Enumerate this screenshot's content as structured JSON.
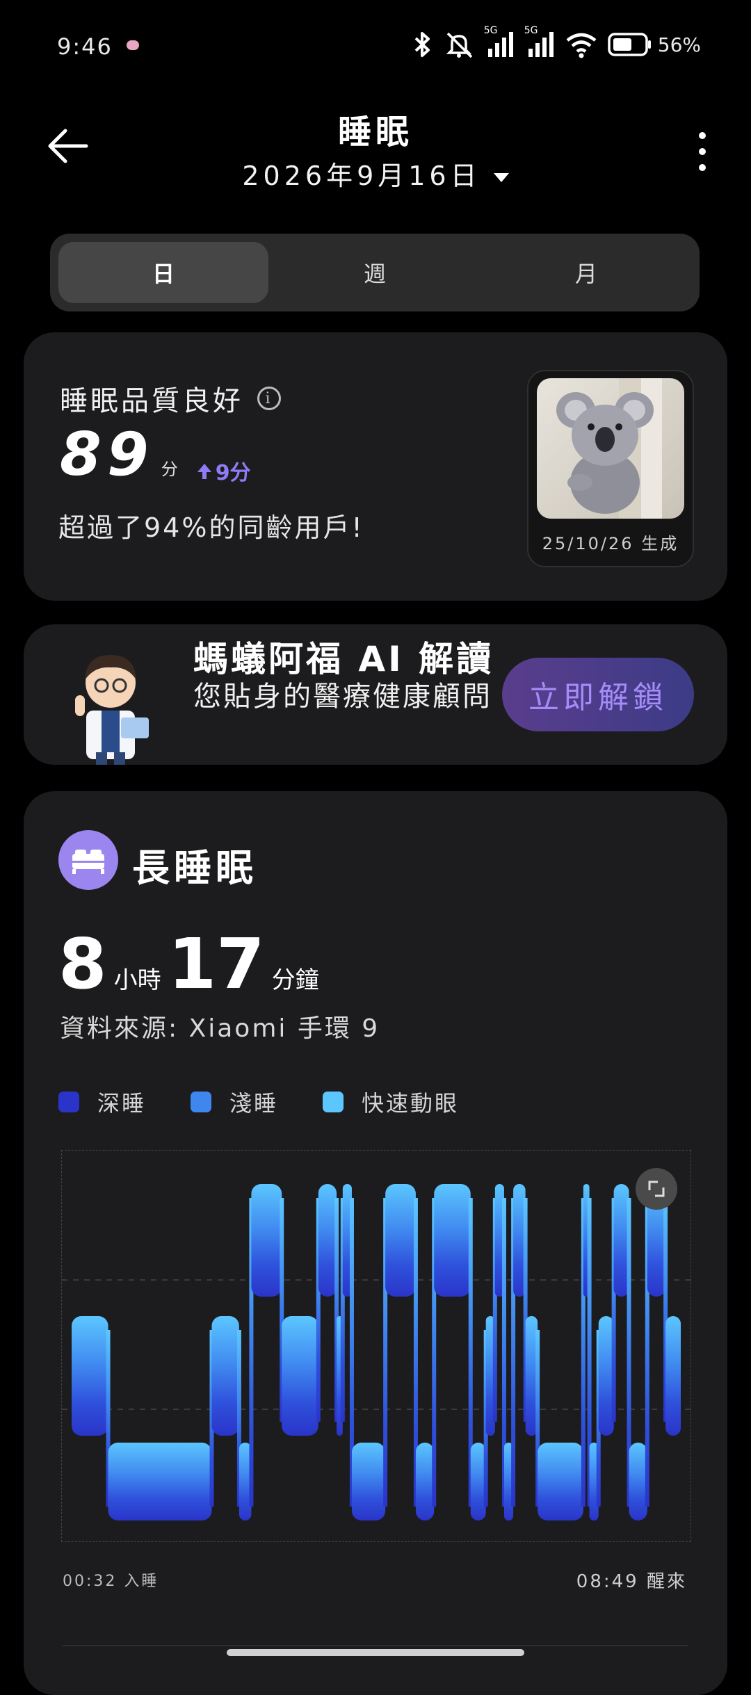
{
  "status_bar": {
    "time": "9:46",
    "battery_text": "56%",
    "signal_tag_1": "5G",
    "signal_tag_2": "5G",
    "icons": [
      "notification-dot-icon",
      "bluetooth-icon",
      "mute-icon",
      "signal-icon",
      "signal-icon",
      "wifi-icon",
      "battery-icon"
    ]
  },
  "header": {
    "title": "睡眠",
    "date": "2026年9月16日"
  },
  "tabs": [
    {
      "label": "日",
      "active": true
    },
    {
      "label": "週",
      "active": false
    },
    {
      "label": "月",
      "active": false
    }
  ],
  "quality_card": {
    "title": "睡眠品質良好",
    "score": "89",
    "score_unit": "分",
    "delta": "9分",
    "beat_text": "超過了94%的同齡用戶!",
    "avatar_caption": "25/10/26 生成"
  },
  "ai_card": {
    "title": "螞蟻阿福 AI 解讀",
    "subtitle": "您貼身的醫療健康顧問",
    "button": "立即解鎖"
  },
  "sleep_card": {
    "title": "長睡眠",
    "hours": "8",
    "hours_unit": "小時",
    "minutes": "17",
    "minutes_unit": "分鐘",
    "source": "資料來源: Xiaomi 手環 9",
    "legend": [
      {
        "label": "深睡",
        "color": "#2a34c9"
      },
      {
        "label": "淺睡",
        "color": "#3f87ef"
      },
      {
        "label": "快速動眼",
        "color": "#5cc6ff"
      }
    ],
    "start_label": "00:32 入睡",
    "end_label": "08:49 醒來"
  },
  "chart_data": {
    "type": "area",
    "title": "",
    "stages": [
      "快速動眼",
      "淺睡",
      "深睡"
    ],
    "x_range": [
      "00:32",
      "08:49"
    ],
    "segments": [
      {
        "stage": "淺睡",
        "start": 0.0,
        "end": 0.06
      },
      {
        "stage": "深睡",
        "start": 0.06,
        "end": 0.23
      },
      {
        "stage": "淺睡",
        "start": 0.23,
        "end": 0.275
      },
      {
        "stage": "深睡",
        "start": 0.275,
        "end": 0.295
      },
      {
        "stage": "快速動眼",
        "start": 0.295,
        "end": 0.345
      },
      {
        "stage": "淺睡",
        "start": 0.345,
        "end": 0.405
      },
      {
        "stage": "快速動眼",
        "start": 0.405,
        "end": 0.435
      },
      {
        "stage": "淺睡",
        "start": 0.435,
        "end": 0.445
      },
      {
        "stage": "快速動眼",
        "start": 0.445,
        "end": 0.46
      },
      {
        "stage": "深睡",
        "start": 0.46,
        "end": 0.515
      },
      {
        "stage": "快速動眼",
        "start": 0.515,
        "end": 0.565
      },
      {
        "stage": "深睡",
        "start": 0.565,
        "end": 0.595
      },
      {
        "stage": "快速動眼",
        "start": 0.595,
        "end": 0.655
      },
      {
        "stage": "深睡",
        "start": 0.655,
        "end": 0.68
      },
      {
        "stage": "淺睡",
        "start": 0.68,
        "end": 0.695
      },
      {
        "stage": "快速動眼",
        "start": 0.695,
        "end": 0.71
      },
      {
        "stage": "深睡",
        "start": 0.71,
        "end": 0.725
      },
      {
        "stage": "快速動眼",
        "start": 0.725,
        "end": 0.745
      },
      {
        "stage": "淺睡",
        "start": 0.745,
        "end": 0.765
      },
      {
        "stage": "深睡",
        "start": 0.765,
        "end": 0.84
      },
      {
        "stage": "快速動眼",
        "start": 0.84,
        "end": 0.85
      },
      {
        "stage": "深睡",
        "start": 0.85,
        "end": 0.865
      },
      {
        "stage": "淺睡",
        "start": 0.865,
        "end": 0.89
      },
      {
        "stage": "快速動眼",
        "start": 0.89,
        "end": 0.915
      },
      {
        "stage": "深睡",
        "start": 0.915,
        "end": 0.945
      },
      {
        "stage": "快速動眼",
        "start": 0.945,
        "end": 0.975
      },
      {
        "stage": "淺睡",
        "start": 0.975,
        "end": 1.0
      }
    ]
  }
}
